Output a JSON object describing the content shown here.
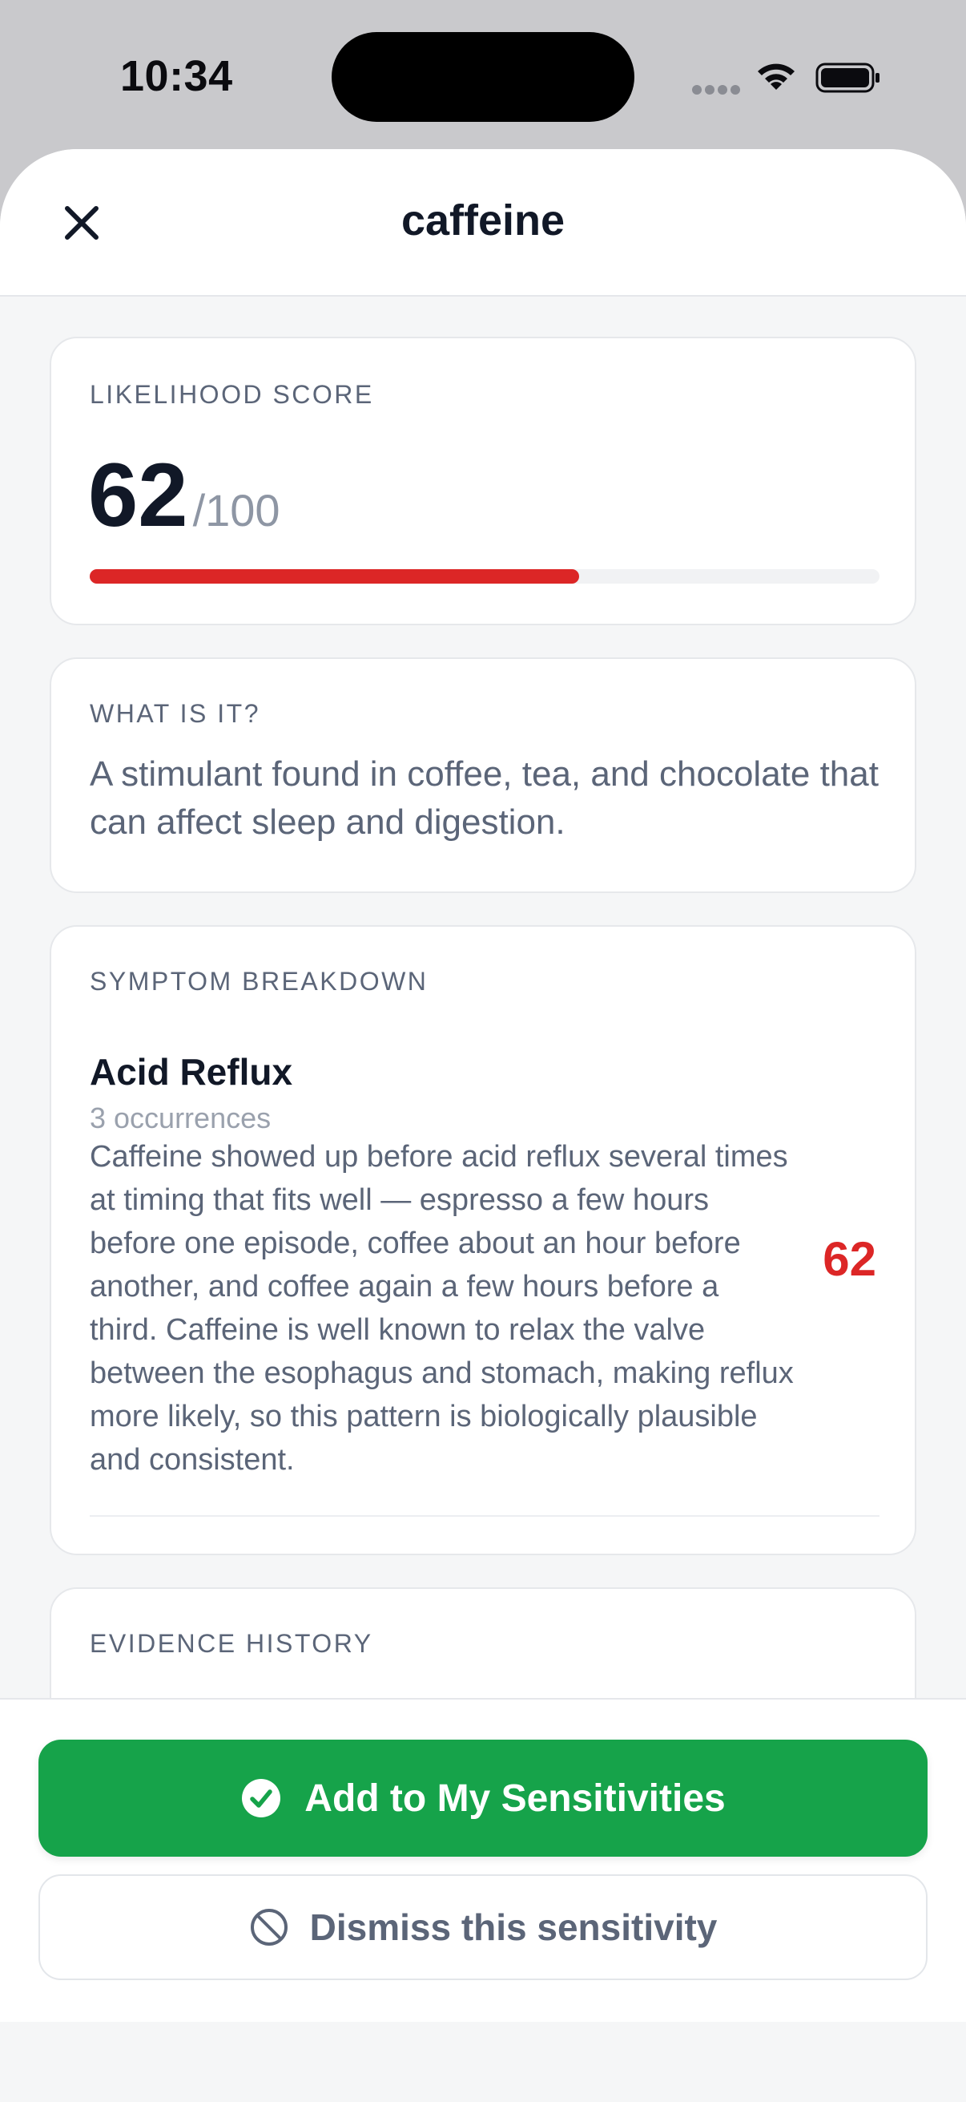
{
  "status_bar": {
    "time": "10:34"
  },
  "sheet": {
    "title": "caffeine"
  },
  "likelihood": {
    "label": "LIKELIHOOD SCORE",
    "score": "62",
    "max": "/100",
    "progress_fraction": 0.62,
    "progress_color": "#dc2626"
  },
  "what_is_it": {
    "label": "WHAT IS IT?",
    "text": "A stimulant found in coffee, tea, and chocolate that can affect sleep and digestion."
  },
  "symptom_breakdown": {
    "label": "SYMPTOM BREAKDOWN",
    "items": [
      {
        "name": "Acid Reflux",
        "occurrences": "3 occurrences",
        "description": "Caffeine showed up before acid reflux several times at timing that fits well — espresso a few hours before one episode, coffee about an hour before another, and coffee again a few hours before a third. Caffeine is well known to relax the valve between the esophagus and stomach, making reflux more likely, so this pattern is biologically plausible and consistent.",
        "score": "62"
      }
    ]
  },
  "evidence_history": {
    "label": "EVIDENCE HISTORY"
  },
  "actions": {
    "primary_label": "Add to My Sensitivities",
    "primary_icon": "check-circle-icon",
    "primary_color": "#16a34a",
    "secondary_label": "Dismiss this sensitivity",
    "secondary_icon": "block-icon"
  }
}
